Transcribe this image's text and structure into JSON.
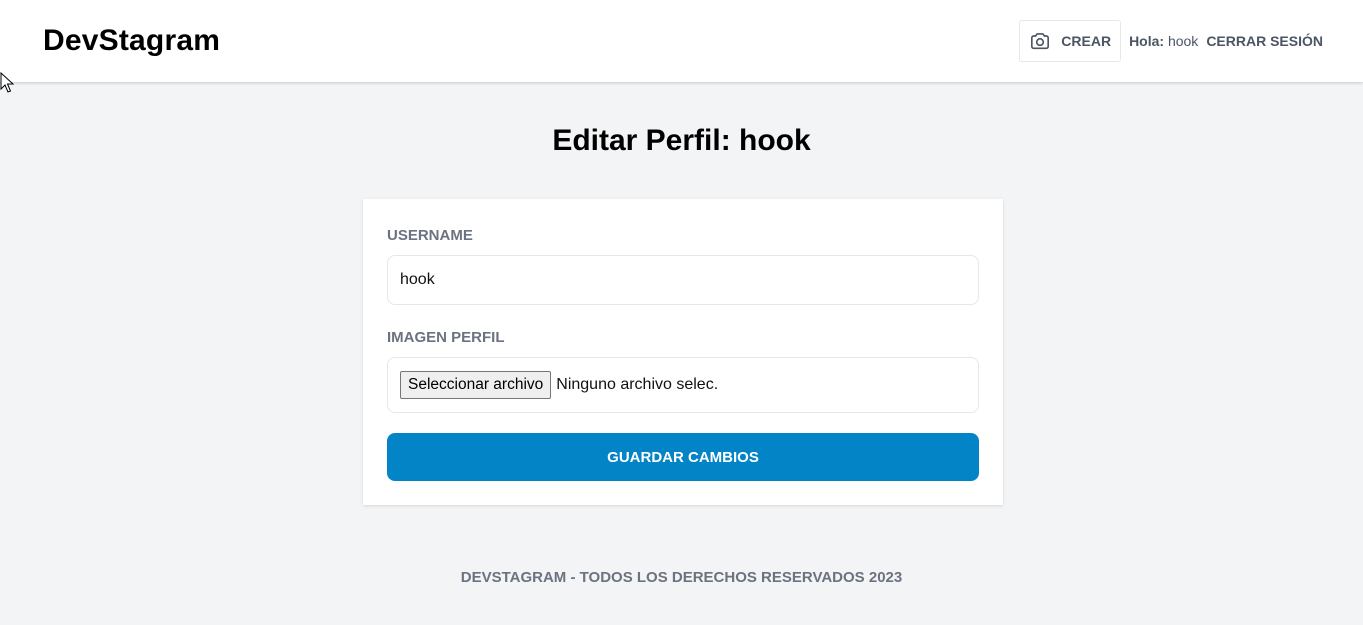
{
  "header": {
    "logo": "DevStagram",
    "create_label": "CREAR",
    "create_icon": "camera-icon",
    "greeting_label": "Hola:",
    "username": "hook",
    "logout_label": "CERRAR SESIÓN"
  },
  "main": {
    "title": "Editar Perfil: hook",
    "form": {
      "username_label": "USERNAME",
      "username_value": "hook",
      "image_label": "IMAGEN PERFIL",
      "file_button_label": "Seleccionar archivo",
      "file_status": "Ninguno archivo selec.",
      "submit_label": "GUARDAR CAMBIOS"
    }
  },
  "footer": {
    "text": "DEVSTAGRAM - TODOS LOS DERECHOS RESERVADOS 2023"
  },
  "colors": {
    "accent": "#0284c7",
    "background": "#f3f4f6",
    "muted_text": "#6b7280"
  }
}
